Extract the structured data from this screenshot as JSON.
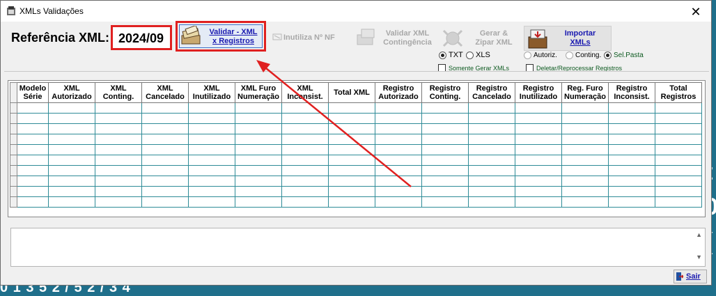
{
  "window": {
    "title": "XMLs Validações",
    "close": "✕"
  },
  "background": {
    "frag1": "t",
    "frag2": "0",
    "frag3": "(",
    "frag4": "0 1 3 5 2 / 5 2 / 3 4"
  },
  "reference": {
    "label": "Referência XML:",
    "value": "2024/09"
  },
  "toolbar": {
    "validar": {
      "line1": "Validar - XML",
      "line2": "x Registros"
    },
    "inutiliza": {
      "label": "Inutiliza Nº NF"
    },
    "contingencia": {
      "line1": "Validar XML",
      "line2": "Contingência"
    },
    "zipar": {
      "line1": "Gerar &",
      "line2": "Zipar XML"
    },
    "importar": {
      "line1": "Importar",
      "line2": "XMLs"
    }
  },
  "options": {
    "txt": "TXT",
    "xls": "XLS",
    "somente": "Somente Gerar XMLs",
    "autoriz": "Autoriz.",
    "conting": "Conting.",
    "selpasta": "Sel.Pasta",
    "deletar": "Deletar/Reprocessar Registros"
  },
  "grid": {
    "columns": [
      [
        "Modelo",
        "Série"
      ],
      [
        "XML",
        "Autorizado"
      ],
      [
        "XML",
        "Conting."
      ],
      [
        "XML",
        "Cancelado"
      ],
      [
        "XML",
        "Inutilizado"
      ],
      [
        "XML Furo",
        "Numeração"
      ],
      [
        "XML",
        "Inconsist."
      ],
      [
        "Total XML",
        ""
      ],
      [
        "Registro",
        "Autorizado"
      ],
      [
        "Registro",
        "Conting."
      ],
      [
        "Registro",
        "Cancelado"
      ],
      [
        "Registro",
        "Inutilizado"
      ],
      [
        "Reg. Furo",
        "Numeração"
      ],
      [
        "Registro",
        "Inconsist."
      ],
      [
        "Total",
        "Registros"
      ]
    ]
  },
  "footer": {
    "sair": "Sair"
  },
  "colors": {
    "accent_red": "#e02020",
    "link_blue": "#1a1ab0",
    "grid_teal": "#2e8b97",
    "bg_teal": "#1f6f8b"
  }
}
